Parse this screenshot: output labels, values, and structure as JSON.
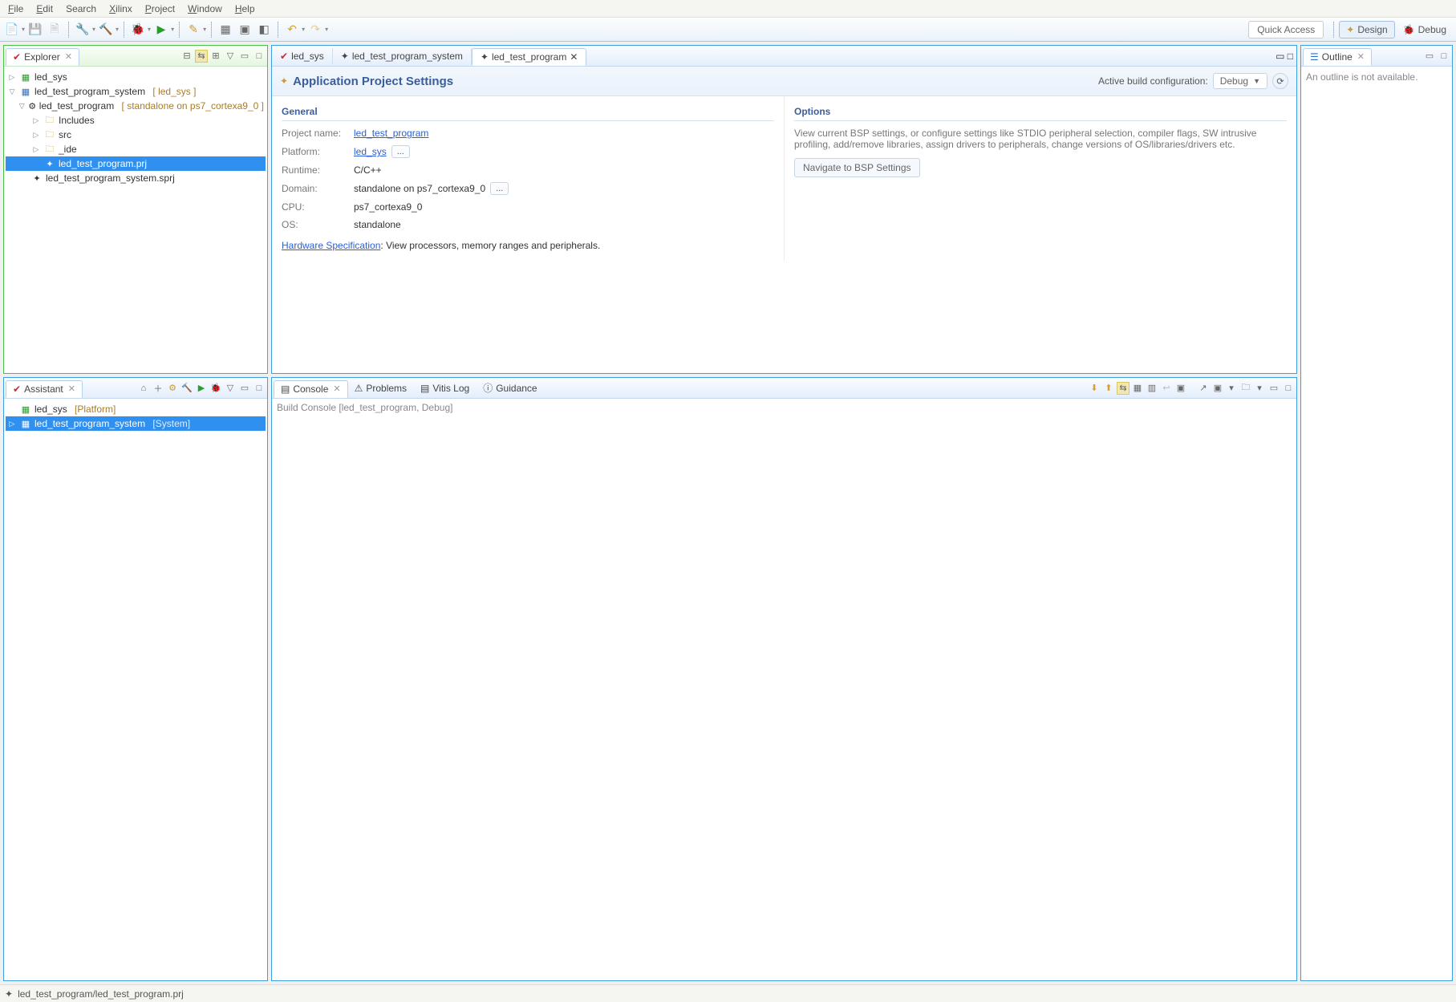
{
  "menu": {
    "file": "File",
    "edit": "Edit",
    "search": "Search",
    "xilinx": "Xilinx",
    "project": "Project",
    "window": "Window",
    "help": "Help"
  },
  "toolbar": {
    "quick_access": "Quick Access",
    "design": "Design",
    "debug": "Debug"
  },
  "explorer": {
    "title": "Explorer",
    "items": {
      "led_sys": "led_sys",
      "system": "led_test_program_system",
      "system_note": "[ led_sys ]",
      "program": "led_test_program",
      "program_note": "[ standalone on ps7_cortexa9_0 ]",
      "includes": "Includes",
      "src": "src",
      "ide": "_ide",
      "prj": "led_test_program.prj",
      "sprj": "led_test_program_system.sprj"
    }
  },
  "assistant": {
    "title": "Assistant",
    "items": {
      "platform": "led_sys",
      "platform_note": "[Platform]",
      "system": "led_test_program_system",
      "system_note": "[System]"
    }
  },
  "editor": {
    "tabs": {
      "t1": "led_sys",
      "t2": "led_test_program_system",
      "t3": "led_test_program"
    },
    "title": "Application Project Settings",
    "active_cfg_label": "Active build configuration:",
    "active_cfg_value": "Debug",
    "general_h": "General",
    "options_h": "Options",
    "fields": {
      "project_label": "Project name:",
      "project_value": "led_test_program",
      "platform_label": "Platform:",
      "platform_value": "led_sys",
      "runtime_label": "Runtime:",
      "runtime_value": "C/C++",
      "domain_label": "Domain:",
      "domain_value": "standalone on ps7_cortexa9_0",
      "cpu_label": "CPU:",
      "cpu_value": "ps7_cortexa9_0",
      "os_label": "OS:",
      "os_value": "standalone",
      "dots": "..."
    },
    "options_desc": "View current BSP settings, or configure settings like STDIO peripheral selection, compiler flags, SW intrusive profiling, add/remove libraries, assign drivers to peripherals, change versions of OS/libraries/drivers etc.",
    "nav_bsp": "Navigate to BSP Settings",
    "hw_spec": "Hardware Specification",
    "hw_spec_rest": ": View processors, memory ranges and peripherals."
  },
  "outline": {
    "title": "Outline",
    "empty": "An outline is not available."
  },
  "console": {
    "tabs": {
      "console": "Console",
      "problems": "Problems",
      "vlog": "Vitis Log",
      "guidance": "Guidance"
    },
    "body": "Build Console [led_test_program, Debug]"
  },
  "status": {
    "path": "led_test_program/led_test_program.prj"
  }
}
